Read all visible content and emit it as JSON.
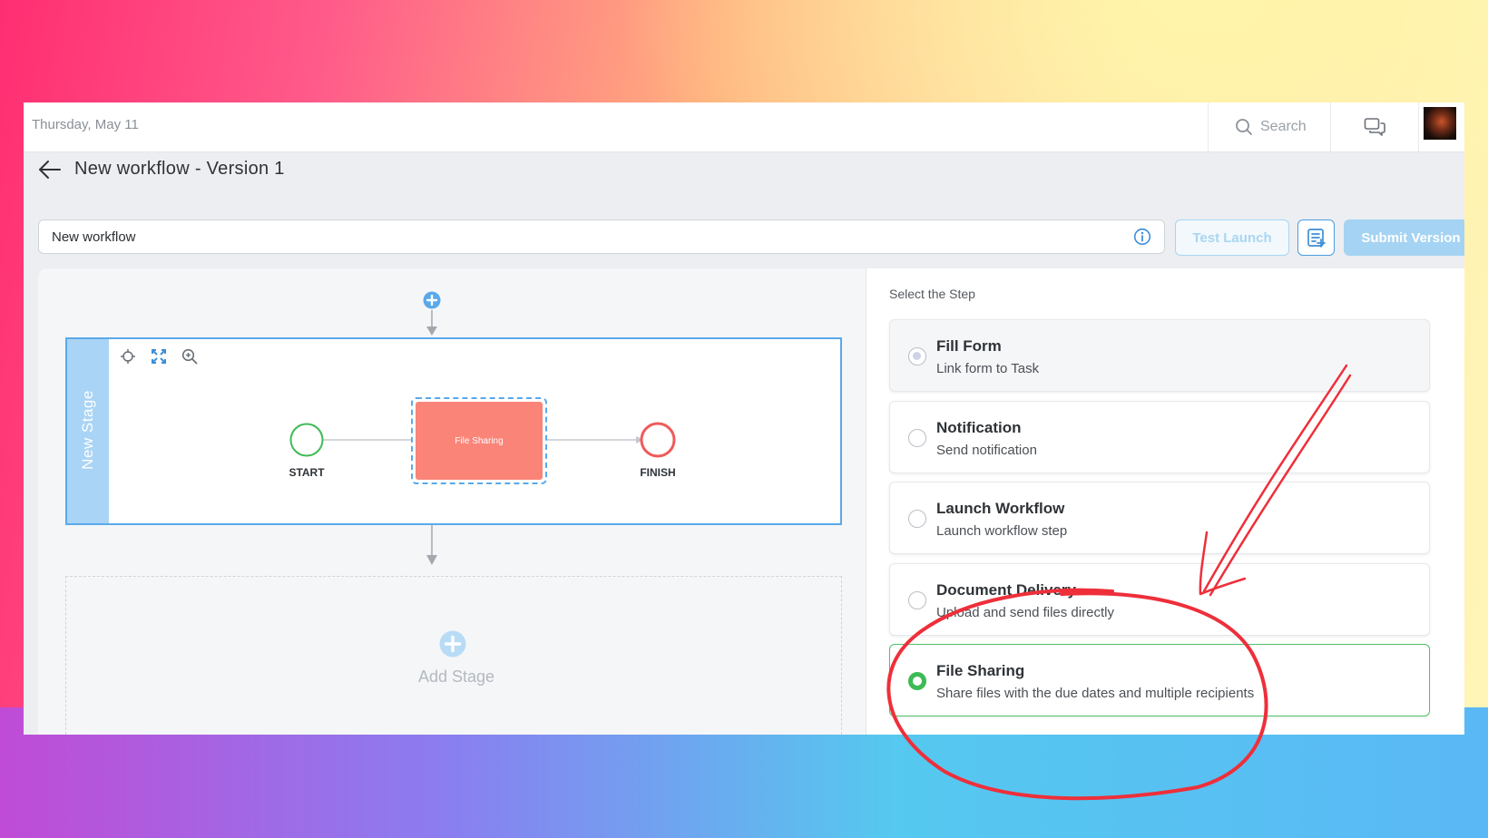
{
  "header": {
    "date": "Thursday, May 11",
    "search_label": "Search"
  },
  "page": {
    "title": "New workflow - Version 1"
  },
  "workflow_name": {
    "value": "New workflow"
  },
  "toolbar": {
    "test_launch_label": "Test Launch",
    "submit_label": "Submit Version"
  },
  "canvas": {
    "stage_label": "New Stage",
    "start_label": "START",
    "task_label": "File Sharing",
    "finish_label": "FINISH",
    "add_stage_label": "Add Stage"
  },
  "steps": {
    "heading": "Select the Step",
    "items": [
      {
        "title": "Fill Form",
        "subtitle": "Link form to Task",
        "state": "disabled"
      },
      {
        "title": "Notification",
        "subtitle": "Send notification",
        "state": "unselected"
      },
      {
        "title": "Launch Workflow",
        "subtitle": "Launch workflow step",
        "state": "unselected"
      },
      {
        "title": "Document Delivery",
        "subtitle": "Upload and send files directly",
        "state": "unselected"
      },
      {
        "title": "File Sharing",
        "subtitle": "Share files with the due dates and multiple recipients",
        "state": "selected"
      }
    ]
  },
  "colors": {
    "accent": "#4c9ee0",
    "task_fill": "#fa8478",
    "start_node": "#3dba55",
    "finish_node": "#f05a5a",
    "selected": "#3dba55",
    "annotation": "#ee2f3a"
  },
  "icons": {
    "back": "arrow-left-icon",
    "search": "search-icon",
    "chat": "chat-icon",
    "info": "info-icon",
    "notes": "notes-add-icon",
    "move": "move-icon",
    "fit": "fit-screen-icon",
    "zoom": "zoom-in-icon",
    "add": "plus-circle-icon"
  }
}
